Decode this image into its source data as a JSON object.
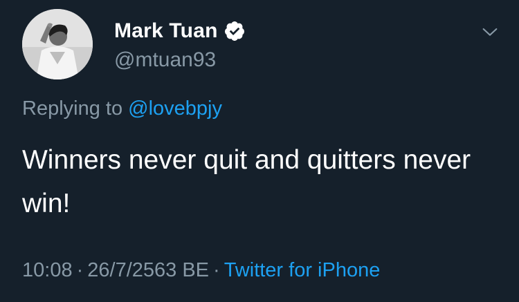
{
  "author": {
    "display_name": "Mark Tuan",
    "handle": "@mtuan93",
    "verified": true,
    "avatar_icon": "profile-photo"
  },
  "reply": {
    "prefix": "Replying to ",
    "mention": "@lovebpjy"
  },
  "tweet": {
    "text": "Winners never quit and quitters never win!"
  },
  "meta": {
    "time": "10:08",
    "date": "26/7/2563 BE",
    "source": "Twitter for iPhone",
    "separator": "·"
  },
  "icons": {
    "verified": "verified-badge-icon",
    "menu": "chevron-down-icon"
  },
  "colors": {
    "background": "#15202b",
    "text_primary": "#ffffff",
    "text_secondary": "#8899a6",
    "accent": "#1da1f2"
  }
}
